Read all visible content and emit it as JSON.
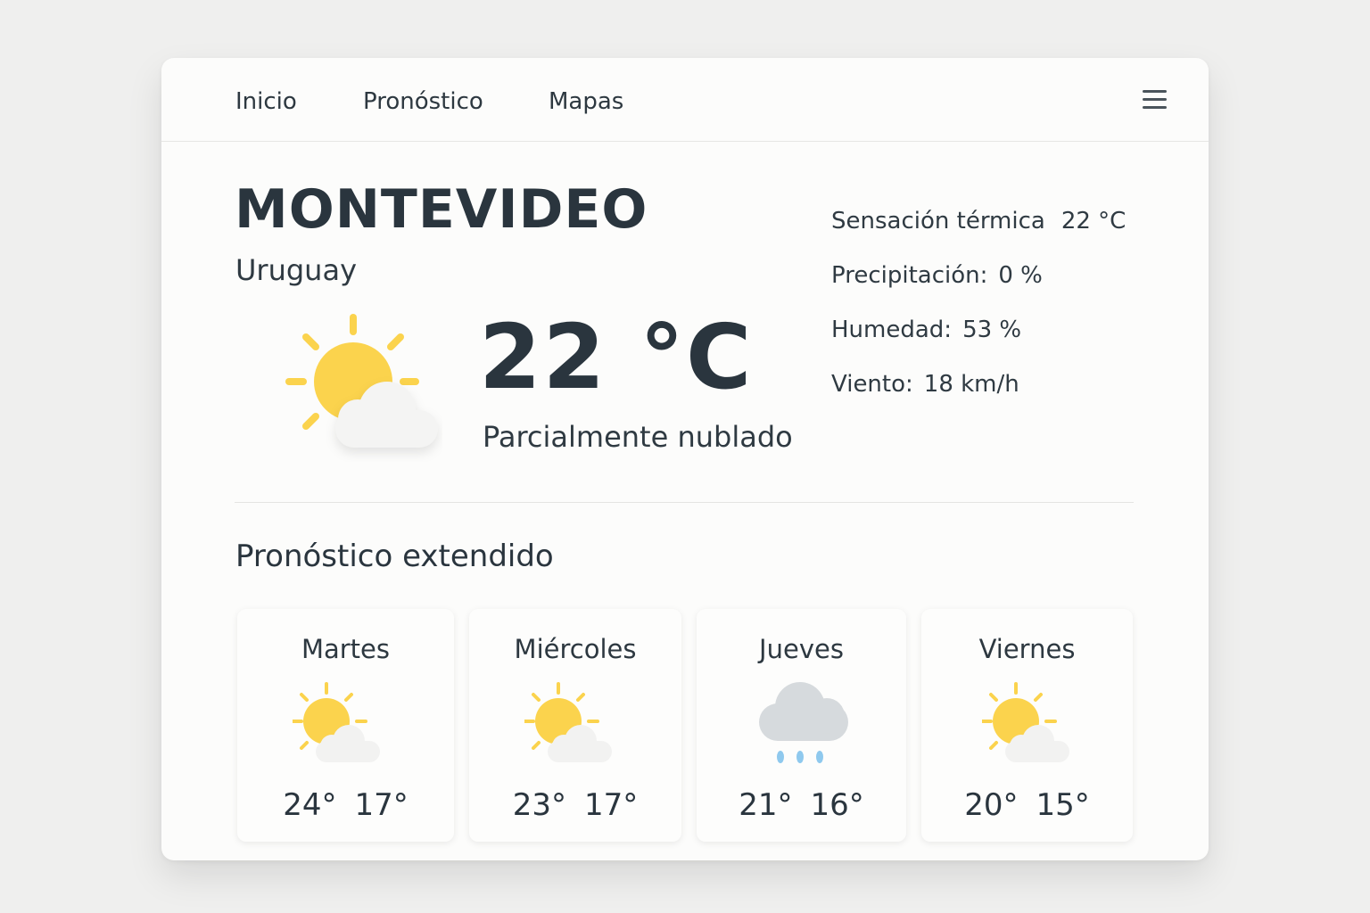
{
  "nav": {
    "items": [
      "Inicio",
      "Pronóstico",
      "Mapas"
    ],
    "menu_icon": "hamburger-menu-icon"
  },
  "current": {
    "city": "MONTEVIDEO",
    "country": "Uruguay",
    "temperature": "22 °C",
    "condition": "Parcialmente nublado",
    "icon": "partly-cloudy-icon",
    "details": [
      {
        "label": "Sensación térmica",
        "value": "22 °C"
      },
      {
        "label": "Precipitación:",
        "value": "0 %"
      },
      {
        "label": "Humedad:",
        "value": "53 %"
      },
      {
        "label": "Viento:",
        "value": "18 km/h"
      }
    ]
  },
  "forecast": {
    "title": "Pronóstico extendido",
    "days": [
      {
        "day": "Martes",
        "high": "24°",
        "low": "17°",
        "icon": "partly-cloudy-icon"
      },
      {
        "day": "Miércoles",
        "high": "23°",
        "low": "17°",
        "icon": "partly-cloudy-icon"
      },
      {
        "day": "Jueves",
        "high": "21°",
        "low": "16°",
        "icon": "rain-cloud-icon"
      },
      {
        "day": "Viernes",
        "high": "20°",
        "low": "15°",
        "icon": "partly-cloudy-icon"
      }
    ]
  },
  "colors": {
    "sun": "#fbd34d",
    "cloud": "#f2f2f2",
    "rain_cloud": "#d6dadd",
    "rain_drop": "#8fc9ee",
    "text": "#2a353e"
  }
}
